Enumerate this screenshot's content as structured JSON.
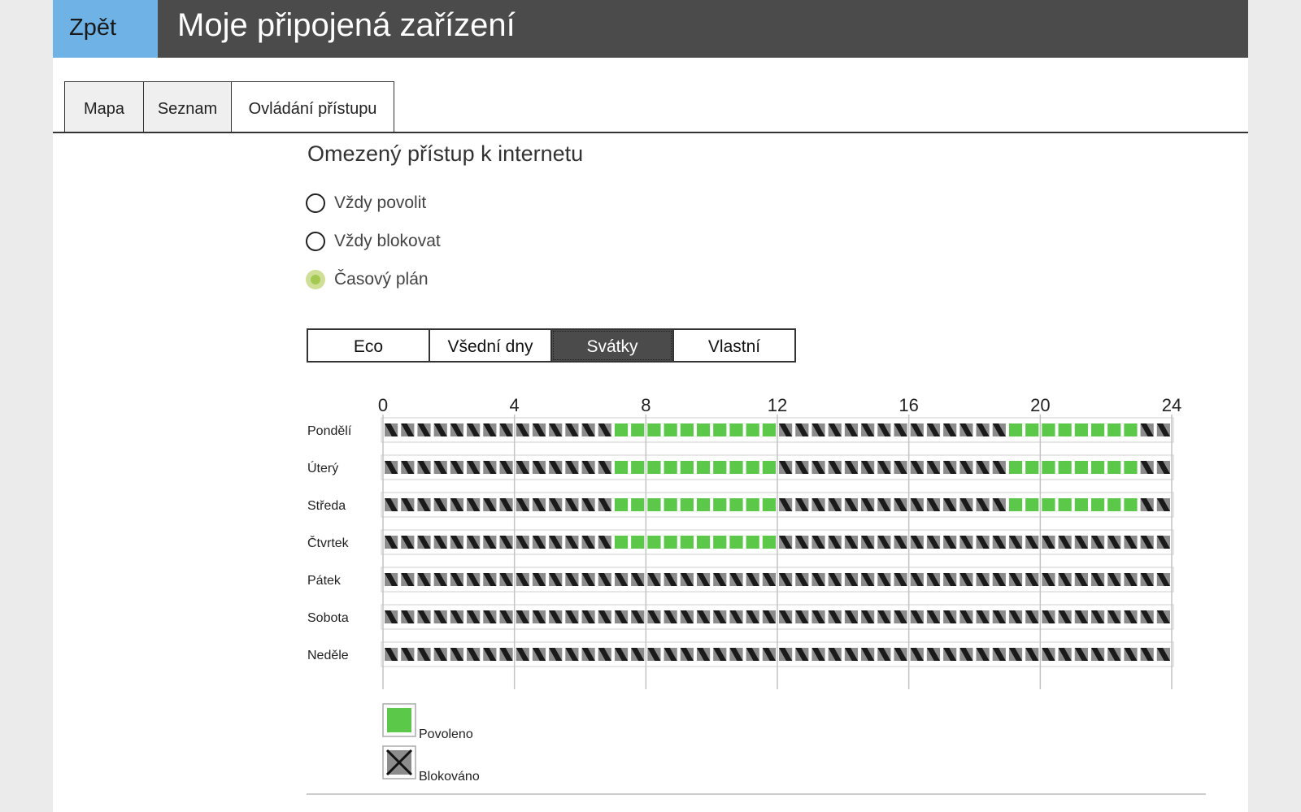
{
  "header": {
    "back_label": "Zpět",
    "title": "Moje připojená zařízení"
  },
  "tabs": [
    {
      "label": "Mapa",
      "active": false
    },
    {
      "label": "Seznam",
      "active": false
    },
    {
      "label": "Ovládání přístupu",
      "active": true
    }
  ],
  "access": {
    "title": "Omezený přístup k internetu",
    "options": [
      {
        "label": "Vždy povolit",
        "selected": false
      },
      {
        "label": "Vždy blokovat",
        "selected": false
      },
      {
        "label": "Časový plán",
        "selected": true
      }
    ]
  },
  "presets": [
    {
      "label": "Eco",
      "active": false
    },
    {
      "label": "Všední dny",
      "active": false
    },
    {
      "label": "Svátky",
      "active": true
    },
    {
      "label": "Vlastní",
      "active": false
    }
  ],
  "schedule": {
    "hour_labels": [
      "0",
      "4",
      "8",
      "12",
      "16",
      "20",
      "24"
    ],
    "slot_minutes": 30,
    "days": [
      {
        "name": "Pondělí",
        "allowed_slots": [
          14,
          15,
          16,
          17,
          18,
          19,
          20,
          21,
          22,
          23,
          38,
          39,
          40,
          41,
          42,
          43,
          44,
          45
        ]
      },
      {
        "name": "Úterý",
        "allowed_slots": [
          14,
          15,
          16,
          17,
          18,
          19,
          20,
          21,
          22,
          23,
          38,
          39,
          40,
          41,
          42,
          43,
          44,
          45
        ]
      },
      {
        "name": "Středa",
        "allowed_slots": [
          14,
          15,
          16,
          17,
          18,
          19,
          20,
          21,
          22,
          23,
          38,
          39,
          40,
          41,
          42,
          43,
          44,
          45
        ]
      },
      {
        "name": "Čtvrtek",
        "allowed_slots": [
          14,
          15,
          16,
          17,
          18,
          19,
          20,
          21,
          22,
          23
        ]
      },
      {
        "name": "Pátek",
        "allowed_slots": []
      },
      {
        "name": "Sobota",
        "allowed_slots": []
      },
      {
        "name": "Neděle",
        "allowed_slots": []
      }
    ]
  },
  "legend": {
    "allowed_label": "Povoleno",
    "blocked_label": "Blokováno"
  },
  "colors": {
    "header_bg": "#4b4b4b",
    "back_button": "#6eb2e6",
    "allowed": "#5cc84a",
    "blocked_bg": "#8c8c8c",
    "radio_selected": "#a4c952"
  }
}
